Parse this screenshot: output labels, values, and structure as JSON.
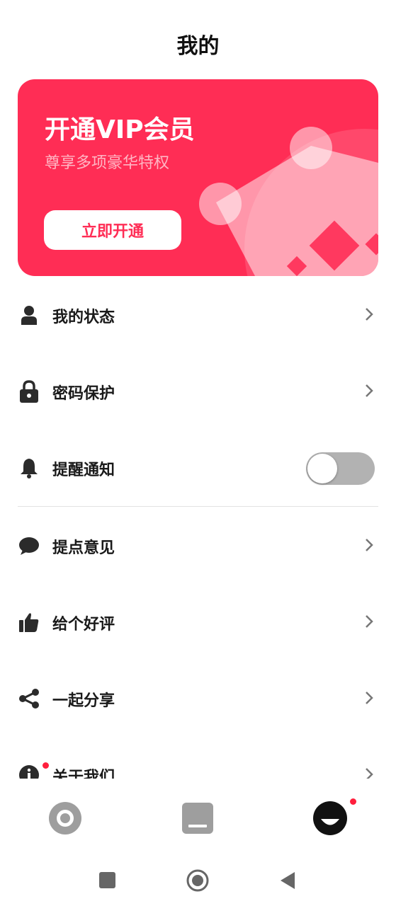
{
  "header": {
    "title": "我的"
  },
  "vip": {
    "title": "开通VIP会员",
    "subtitle": "尊享多项豪华特权",
    "button_label": "立即开通",
    "bg_color": "#ff2d55"
  },
  "menu": [
    {
      "label": "我的状态",
      "icon": "user-icon",
      "control": "chevron"
    },
    {
      "label": "密码保护",
      "icon": "lock-icon",
      "control": "chevron"
    },
    {
      "label": "提醒通知",
      "icon": "bell-icon",
      "control": "toggle",
      "toggle_on": false
    },
    {
      "label": "提点意见",
      "icon": "chat-bubble-icon",
      "control": "chevron"
    },
    {
      "label": "给个好评",
      "icon": "thumbs-up-icon",
      "control": "chevron"
    },
    {
      "label": "一起分享",
      "icon": "share-icon",
      "control": "chevron"
    },
    {
      "label": "关于我们",
      "icon": "info-icon",
      "control": "chevron",
      "badge": true
    }
  ],
  "tabbar": {
    "tabs": [
      {
        "icon": "record-icon",
        "active": false
      },
      {
        "icon": "window-icon",
        "active": false
      },
      {
        "icon": "smile-icon",
        "active": true,
        "badge": true
      }
    ]
  },
  "system_nav": {
    "buttons": [
      "recents-icon",
      "home-icon",
      "back-icon"
    ]
  },
  "colors": {
    "accent": "#ff2d55",
    "badge": "#ff1f3d",
    "inactive": "#9e9e9e",
    "text": "#1a1a1a"
  }
}
